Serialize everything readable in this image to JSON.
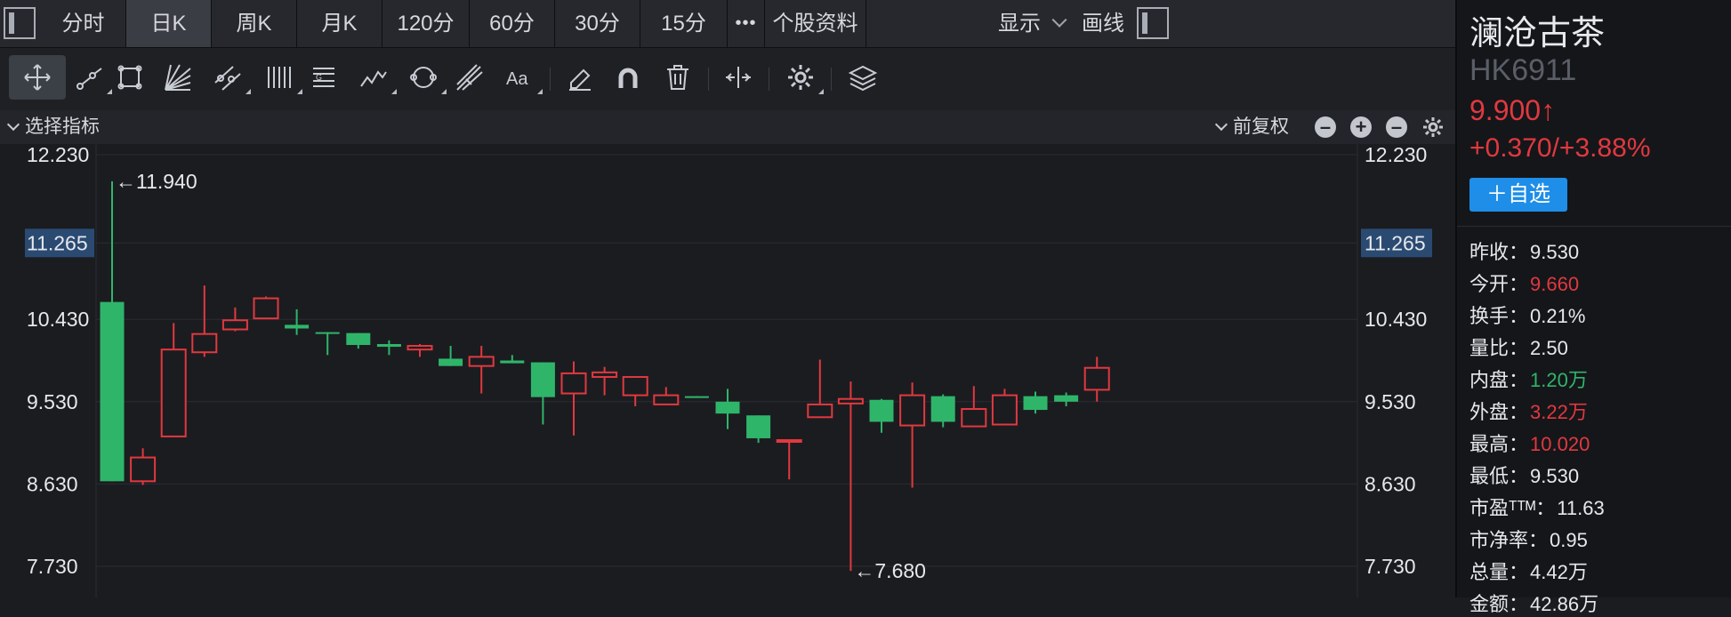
{
  "tabs": [
    "分时",
    "日K",
    "周K",
    "月K",
    "120分",
    "60分",
    "30分",
    "15分",
    "•••",
    "个股资料"
  ],
  "active_tab": "日K",
  "right_menu": {
    "display_label": "显示",
    "draw_label": "画线"
  },
  "indicator_bar": {
    "select_label": "选择指标",
    "adjust_label": "前复权"
  },
  "colors": {
    "up": "#e0393f",
    "down": "#2fb56a",
    "accent": "#1e8ee8",
    "highlight_label_bg": "#2a4a72"
  },
  "chart_data": {
    "type": "candlestick",
    "y_ticks": [
      "12.230",
      "11.265",
      "10.430",
      "9.530",
      "8.630",
      "7.730"
    ],
    "highlight_tick": "11.265",
    "ylim": [
      7.73,
      12.23
    ],
    "annotations": {
      "max_label": "←11.940",
      "min_label": "←7.680"
    },
    "candles": [
      {
        "o": 10.62,
        "c": 8.66,
        "h": 11.94,
        "l": 8.66
      },
      {
        "o": 8.66,
        "c": 8.92,
        "h": 9.02,
        "l": 8.62
      },
      {
        "o": 9.15,
        "c": 10.1,
        "h": 10.39,
        "l": 9.15
      },
      {
        "o": 10.07,
        "c": 10.27,
        "h": 10.8,
        "l": 10.02
      },
      {
        "o": 10.32,
        "c": 10.42,
        "h": 10.56,
        "l": 10.3
      },
      {
        "o": 10.44,
        "c": 10.66,
        "h": 10.68,
        "l": 10.44
      },
      {
        "o": 10.37,
        "c": 10.33,
        "h": 10.54,
        "l": 10.26
      },
      {
        "o": 10.29,
        "c": 10.28,
        "h": 10.29,
        "l": 10.04
      },
      {
        "o": 10.28,
        "c": 10.15,
        "h": 10.28,
        "l": 10.11
      },
      {
        "o": 10.16,
        "c": 10.13,
        "h": 10.2,
        "l": 10.04
      },
      {
        "o": 10.1,
        "c": 10.14,
        "h": 10.16,
        "l": 10.02
      },
      {
        "o": 10.0,
        "c": 9.92,
        "h": 10.14,
        "l": 9.92
      },
      {
        "o": 9.92,
        "c": 10.02,
        "h": 10.14,
        "l": 9.62
      },
      {
        "o": 9.98,
        "c": 9.95,
        "h": 10.04,
        "l": 9.95
      },
      {
        "o": 9.96,
        "c": 9.58,
        "h": 9.96,
        "l": 9.28
      },
      {
        "o": 9.62,
        "c": 9.84,
        "h": 9.97,
        "l": 9.16
      },
      {
        "o": 9.8,
        "c": 9.85,
        "h": 9.91,
        "l": 9.6
      },
      {
        "o": 9.6,
        "c": 9.8,
        "h": 9.8,
        "l": 9.48
      },
      {
        "o": 9.5,
        "c": 9.6,
        "h": 9.69,
        "l": 9.5
      },
      {
        "o": 9.59,
        "c": 9.58,
        "h": 9.59,
        "l": 9.58
      },
      {
        "o": 9.53,
        "c": 9.4,
        "h": 9.67,
        "l": 9.23
      },
      {
        "o": 9.38,
        "c": 9.13,
        "h": 9.38,
        "l": 9.08
      },
      {
        "o": 9.1,
        "c": 9.11,
        "h": 9.11,
        "l": 8.68
      },
      {
        "o": 9.36,
        "c": 9.5,
        "h": 9.99,
        "l": 9.36
      },
      {
        "o": 9.51,
        "c": 9.56,
        "h": 9.75,
        "l": 7.68
      },
      {
        "o": 9.55,
        "c": 9.31,
        "h": 9.56,
        "l": 9.19
      },
      {
        "o": 9.27,
        "c": 9.6,
        "h": 9.74,
        "l": 8.59
      },
      {
        "o": 9.59,
        "c": 9.31,
        "h": 9.61,
        "l": 9.25
      },
      {
        "o": 9.26,
        "c": 9.45,
        "h": 9.7,
        "l": 9.26
      },
      {
        "o": 9.28,
        "c": 9.6,
        "h": 9.67,
        "l": 9.28
      },
      {
        "o": 9.59,
        "c": 9.44,
        "h": 9.64,
        "l": 9.4
      },
      {
        "o": 9.6,
        "c": 9.53,
        "h": 9.63,
        "l": 9.48
      },
      {
        "o": 9.66,
        "c": 9.9,
        "h": 10.02,
        "l": 9.53
      }
    ]
  },
  "stock": {
    "name": "澜沧古茶",
    "code": "HK6911",
    "price": "9.900↑",
    "change": "+0.370/+3.88%",
    "watch_button": "＋自选",
    "stats": [
      {
        "label": "昨收：",
        "value": "9.530",
        "tone": ""
      },
      {
        "label": "今开：",
        "value": "9.660",
        "tone": "up"
      },
      {
        "label": "换手：",
        "value": "0.21%",
        "tone": ""
      },
      {
        "label": "量比：",
        "value": "2.50",
        "tone": ""
      },
      {
        "label": "内盘：",
        "value": "1.20万",
        "tone": "down"
      },
      {
        "label": "外盘：",
        "value": "3.22万",
        "tone": "up"
      },
      {
        "label": "最高：",
        "value": "10.020",
        "tone": "up"
      },
      {
        "label": "最低：",
        "value": "9.530",
        "tone": ""
      },
      {
        "label": "市盈ᵀᵀᴹ：",
        "value": "11.63",
        "tone": ""
      },
      {
        "label": "市净率：",
        "value": "0.95",
        "tone": ""
      },
      {
        "label": "总量：",
        "value": "4.42万",
        "tone": ""
      },
      {
        "label": "金额：",
        "value": "42.86万",
        "tone": ""
      }
    ]
  },
  "toolbar": {
    "tools": [
      "move-cursor-icon",
      "line-segment-icon",
      "crop-icon",
      "fan-lines-icon",
      "parallel-channel-icon",
      "vertical-lines-icon",
      "fibonacci-icon",
      "wave-icon",
      "cycle-icon",
      "pitchfork-icon",
      "text-tool-icon",
      "eraser-icon",
      "magnet-icon",
      "trash-icon",
      "split-view-icon",
      "settings-icon",
      "layers-icon"
    ]
  }
}
